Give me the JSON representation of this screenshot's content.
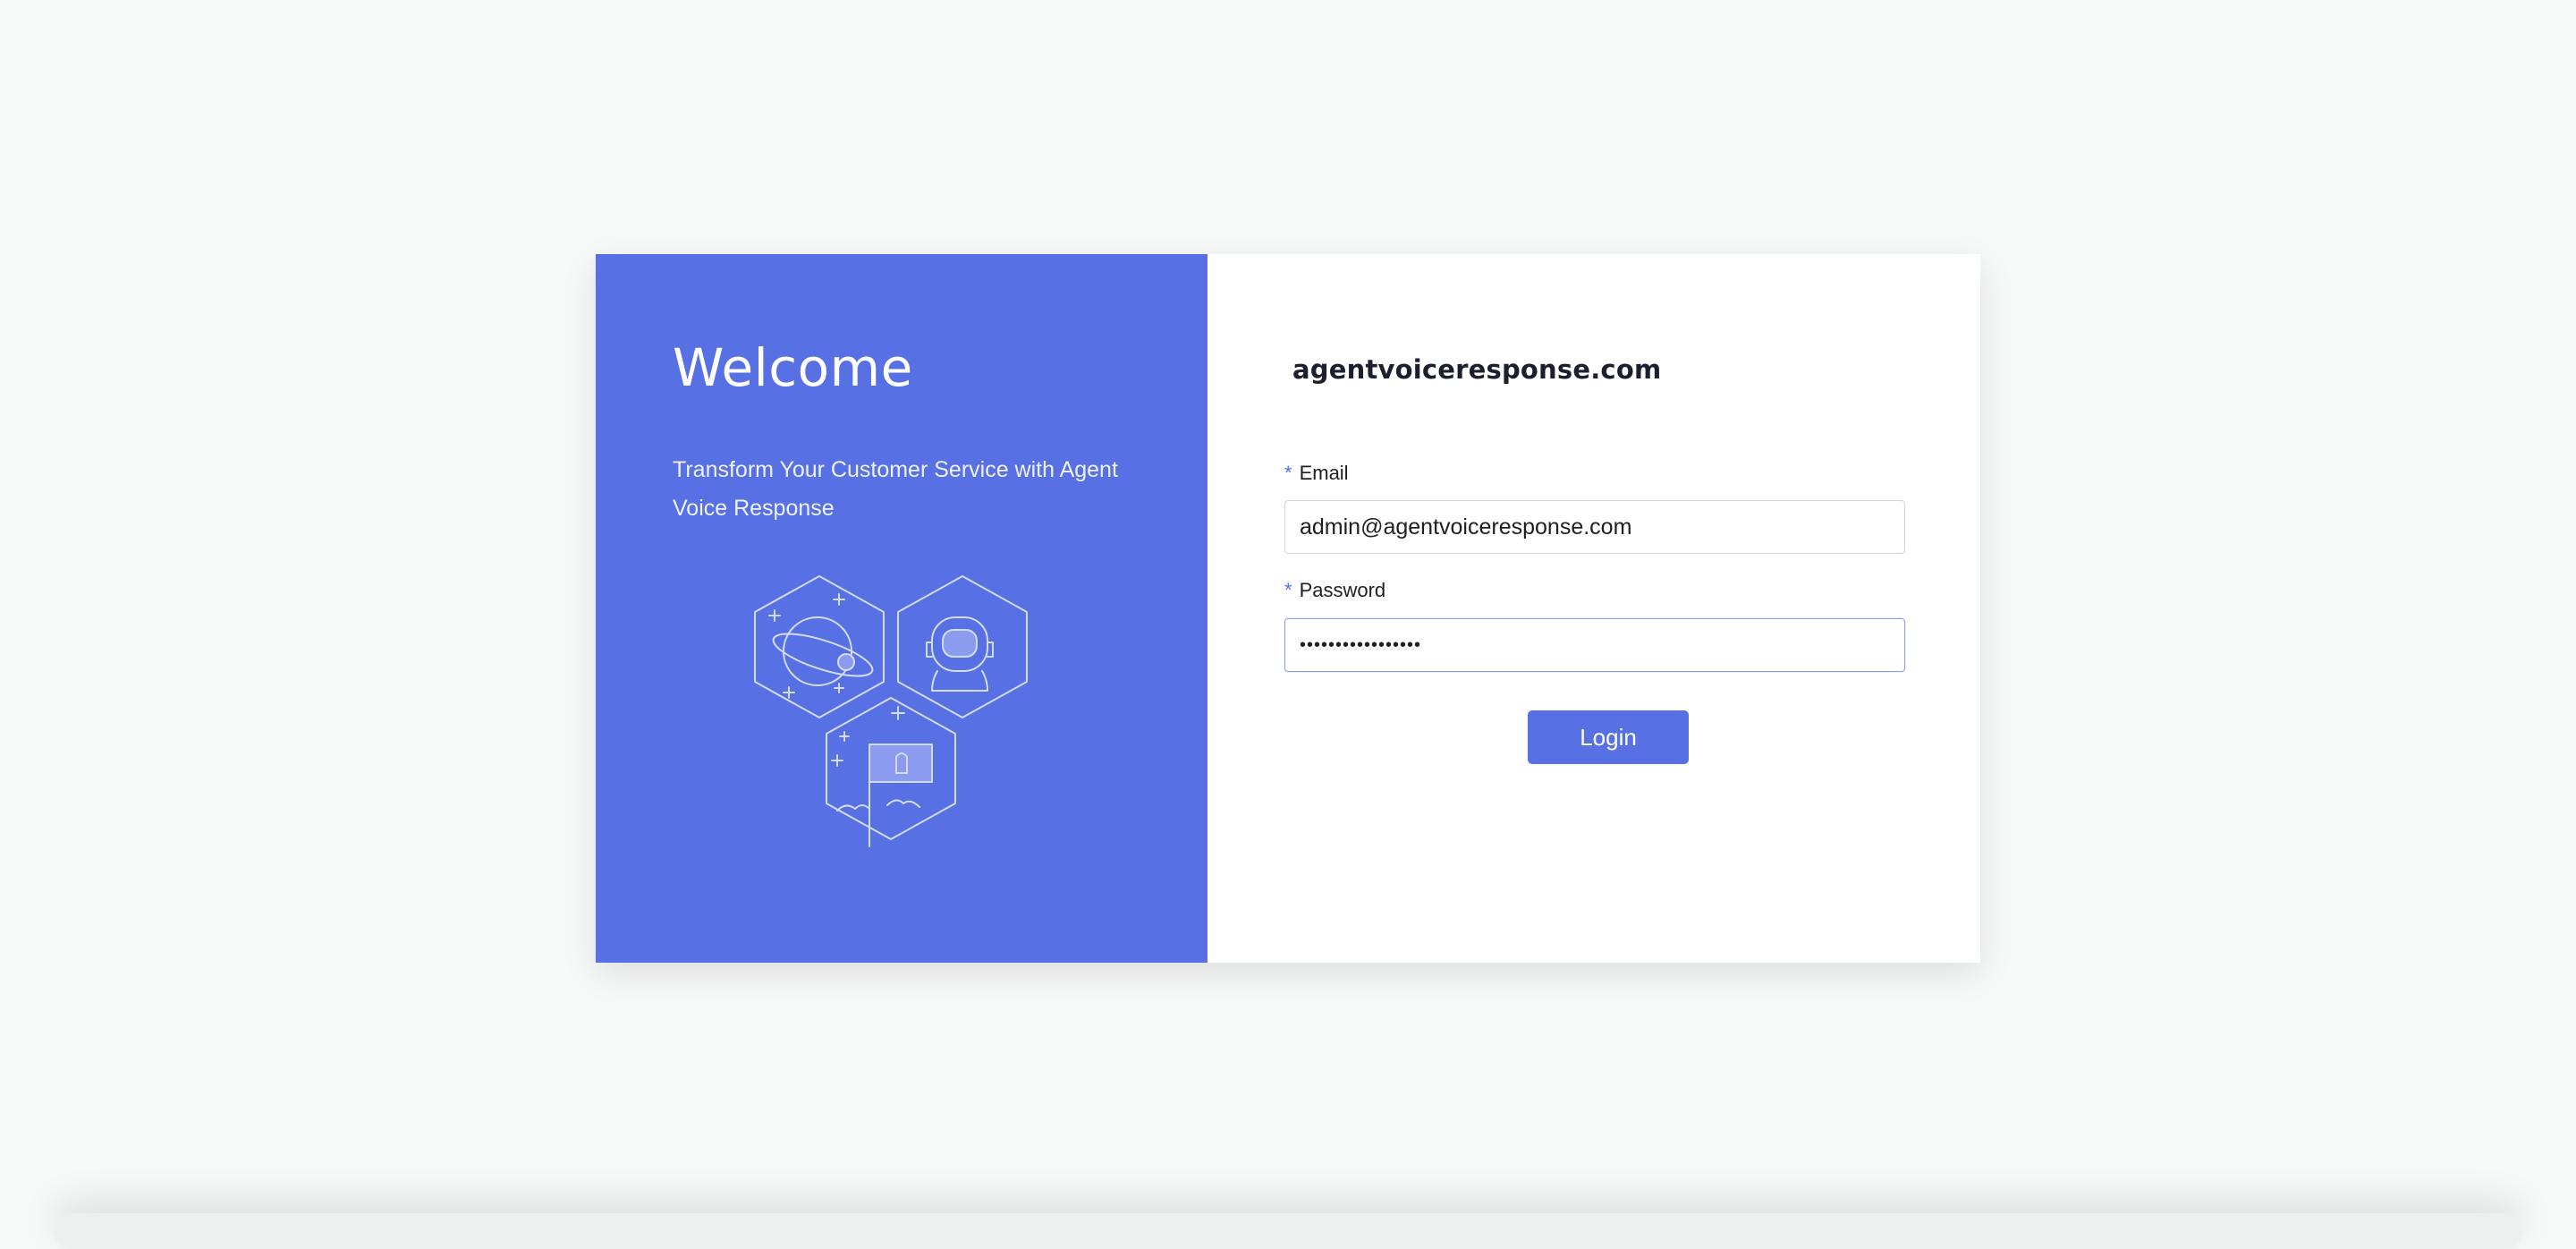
{
  "left": {
    "title": "Welcome",
    "subtitle": "Transform Your Customer Service with Agent Voice Response",
    "illustration_icon": "space-illustration-icon"
  },
  "right": {
    "brand": "agentvoiceresponse.com",
    "email": {
      "required_mark": "*",
      "label": "Email",
      "value": "admin@agentvoiceresponse.com"
    },
    "password": {
      "required_mark": "*",
      "label": "Password",
      "value": "•••••••••••••••••"
    },
    "login_label": "Login"
  },
  "colors": {
    "accent": "#5770e4",
    "background": "#f7f8f8"
  }
}
